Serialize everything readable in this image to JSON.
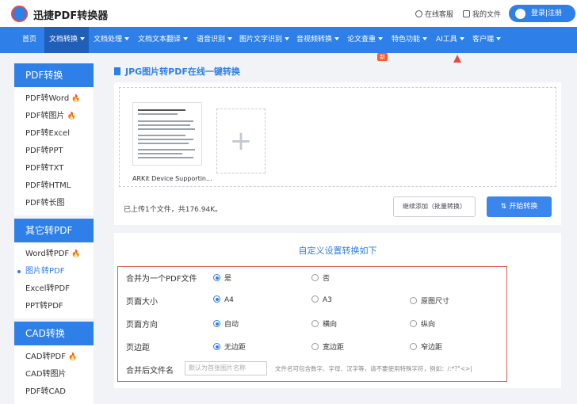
{
  "header": {
    "brand": "迅捷PDF转换器",
    "service": "在线客服",
    "my_files": "我的文件",
    "login": "登录|注册"
  },
  "nav": {
    "items": [
      "首页",
      "文档转换",
      "文档处理",
      "文档文本翻译",
      "语音识别",
      "图片文字识别",
      "音视频转换",
      "论文查重",
      "特色功能",
      "AI工具",
      "客户端"
    ],
    "new_badge": "新"
  },
  "sidebar": {
    "group1_title": "PDF转换",
    "group1": [
      "PDF转Word",
      "PDF转图片",
      "PDF转Excel",
      "PDF转PPT",
      "PDF转TXT",
      "PDF转HTML",
      "PDF转长图"
    ],
    "group2_title": "其它转PDF",
    "group2": [
      "Word转PDF",
      "图片转PDF",
      "Excel转PDF",
      "PPT转PDF"
    ],
    "group3_title": "CAD转换",
    "group3": [
      "CAD转PDF",
      "CAD转图片",
      "PDF转CAD"
    ],
    "fire": "🔥"
  },
  "main": {
    "title": "JPG图片转PDF在线一键转换",
    "file_name": "ARKit Device Supportin...",
    "add_symbol": "+",
    "upload_info": "已上传1个文件，共176.94K。",
    "continue_label": "继续添加（批量转换）",
    "convert_label": "开始转换"
  },
  "settings": {
    "title": "自定义设置转换如下",
    "merge_label": "合并为一个PDF文件",
    "merge_yes": "是",
    "merge_no": "否",
    "size_label": "页面大小",
    "size_a4": "A4",
    "size_a3": "A3",
    "size_orig": "原图尺寸",
    "orient_label": "页面方向",
    "orient_auto": "自动",
    "orient_land": "横向",
    "orient_port": "纵向",
    "margin_label": "页边距",
    "margin_none": "无边距",
    "margin_wide": "宽边距",
    "margin_narrow": "窄边距",
    "filename_label": "合并后文件名",
    "filename_placeholder": "默认为首张图片名称",
    "filename_hint": "文件名可包含数字、字母、汉字等，请不要使用特殊字符，例如：/:*?\"<>|"
  }
}
